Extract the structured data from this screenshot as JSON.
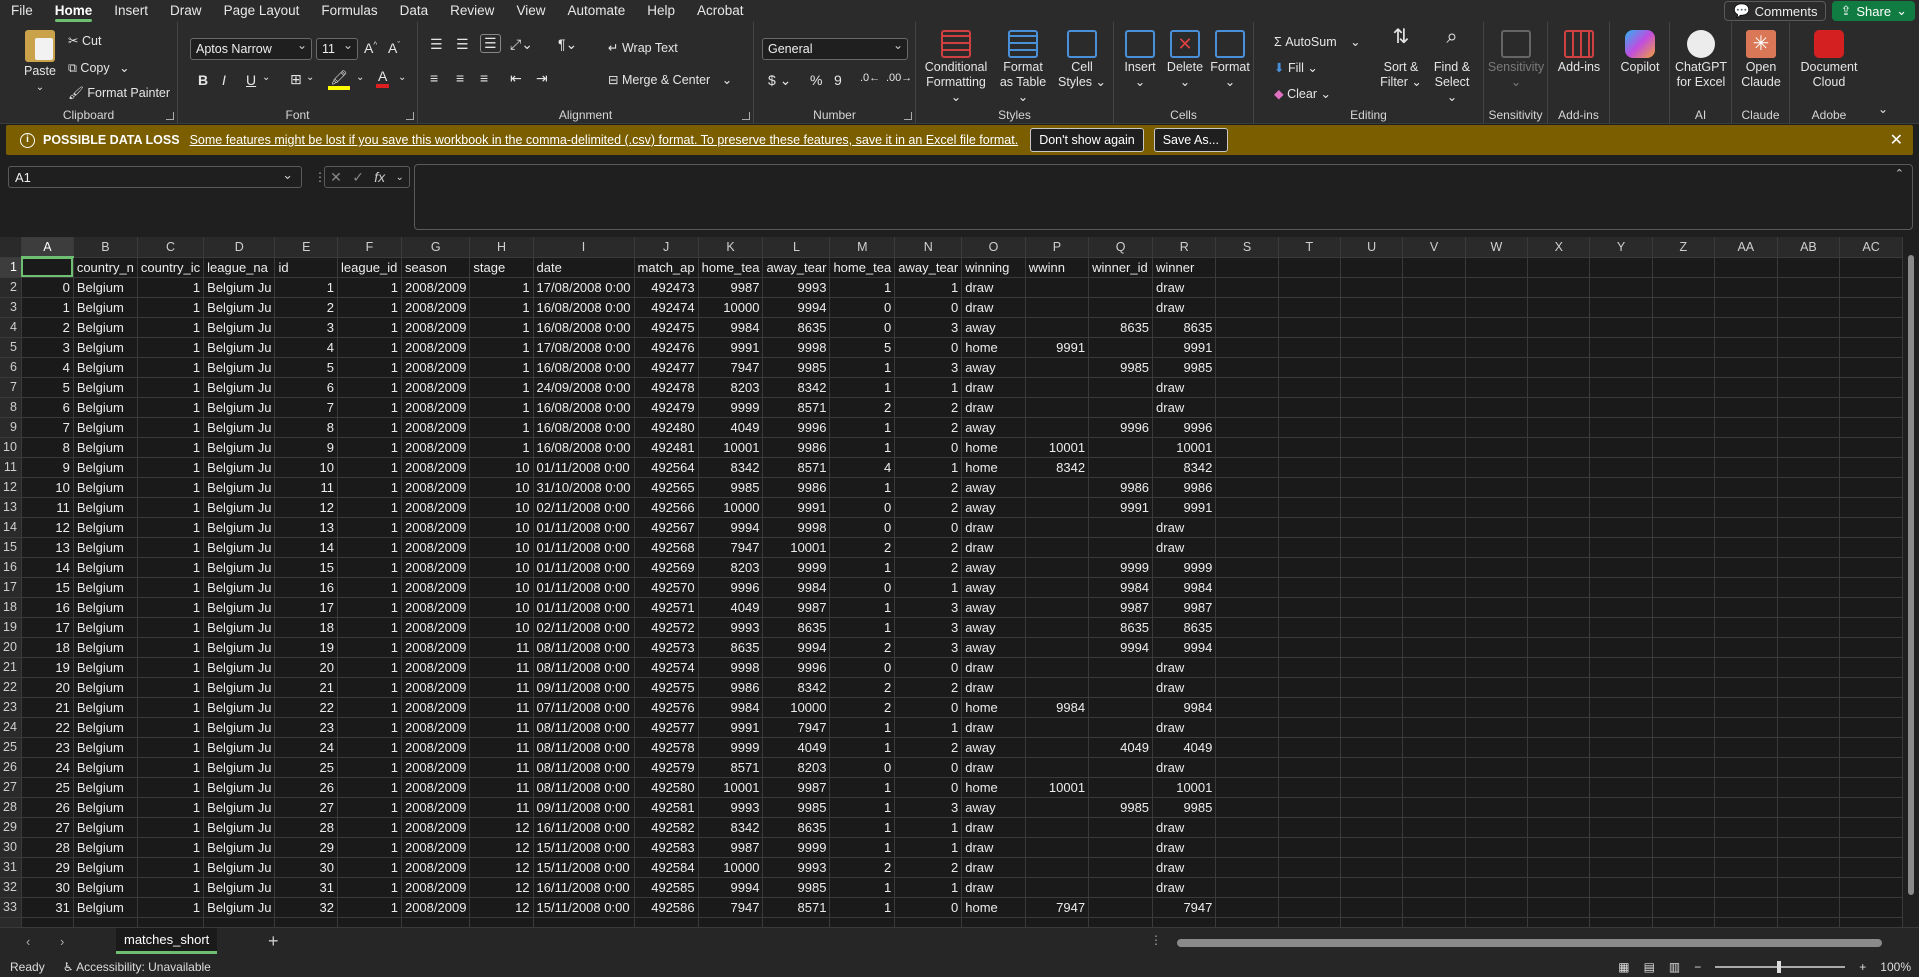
{
  "menu": {
    "items": [
      "File",
      "Home",
      "Insert",
      "Draw",
      "Page Layout",
      "Formulas",
      "Data",
      "Review",
      "View",
      "Automate",
      "Help",
      "Acrobat"
    ],
    "active": "Home",
    "comments_label": "Comments",
    "share_label": "Share"
  },
  "ribbon": {
    "clipboard": {
      "label": "Clipboard",
      "paste": "Paste",
      "cut": "Cut",
      "copy": "Copy",
      "format_painter": "Format Painter"
    },
    "font": {
      "label": "Font",
      "font_name": "Aptos Narrow",
      "font_size": "11"
    },
    "alignment": {
      "label": "Alignment",
      "wrap_text": "Wrap Text",
      "merge_center": "Merge & Center"
    },
    "number": {
      "label": "Number",
      "format": "General"
    },
    "styles": {
      "label": "Styles",
      "conditional": "Conditional Formatting",
      "format_table": "Format as Table",
      "cell_styles": "Cell Styles"
    },
    "cells": {
      "label": "Cells",
      "insert": "Insert",
      "delete": "Delete",
      "format": "Format"
    },
    "editing": {
      "label": "Editing",
      "autosum": "AutoSum",
      "fill": "Fill",
      "clear": "Clear",
      "sort_filter": "Sort & Filter",
      "find_select": "Find & Select"
    },
    "sensitivity": {
      "label": "Sensitivity",
      "button": "Sensitivity"
    },
    "addins": {
      "label": "Add-ins",
      "button": "Add-ins"
    },
    "copilot": {
      "button": "Copilot"
    },
    "ai": {
      "label": "AI",
      "button": "ChatGPT for Excel"
    },
    "claude": {
      "label": "Claude",
      "button": "Open Claude"
    },
    "adobe": {
      "label": "Adobe",
      "button": "Document Cloud"
    }
  },
  "message_bar": {
    "title": "POSSIBLE DATA LOSS",
    "text": "Some features might be lost if you save this workbook in the comma-delimited (.csv) format. To preserve these features, save it in an Excel file format.",
    "dont_show": "Don't show again",
    "save_as": "Save As..."
  },
  "formula_bar": {
    "name_box": "A1",
    "formula": ""
  },
  "grid": {
    "columns": [
      "A",
      "B",
      "C",
      "D",
      "E",
      "F",
      "G",
      "H",
      "I",
      "J",
      "K",
      "L",
      "M",
      "N",
      "O",
      "P",
      "Q",
      "R",
      "S",
      "T",
      "U",
      "V",
      "W",
      "X",
      "Y",
      "Z",
      "AA",
      "AB",
      "AC"
    ],
    "header_row": [
      "",
      "country_n",
      "country_ic",
      "league_na",
      "id",
      "league_id",
      "season",
      "stage",
      "date",
      "match_ap",
      "home_tea",
      "away_tear",
      "home_tea",
      "away_tear",
      "winning",
      "wwinn",
      "winner_id",
      "winner"
    ],
    "rows": [
      [
        "0",
        "Belgium",
        "1",
        "Belgium Ju",
        "1",
        "1",
        "2008/2009",
        "1",
        "17/08/2008 0:00",
        "492473",
        "9987",
        "9993",
        "1",
        "1",
        "draw",
        "",
        "",
        "draw"
      ],
      [
        "1",
        "Belgium",
        "1",
        "Belgium Ju",
        "2",
        "1",
        "2008/2009",
        "1",
        "16/08/2008 0:00",
        "492474",
        "10000",
        "9994",
        "0",
        "0",
        "draw",
        "",
        "",
        "draw"
      ],
      [
        "2",
        "Belgium",
        "1",
        "Belgium Ju",
        "3",
        "1",
        "2008/2009",
        "1",
        "16/08/2008 0:00",
        "492475",
        "9984",
        "8635",
        "0",
        "3",
        "away",
        "",
        "8635",
        "8635"
      ],
      [
        "3",
        "Belgium",
        "1",
        "Belgium Ju",
        "4",
        "1",
        "2008/2009",
        "1",
        "17/08/2008 0:00",
        "492476",
        "9991",
        "9998",
        "5",
        "0",
        "home",
        "9991",
        "",
        "9991"
      ],
      [
        "4",
        "Belgium",
        "1",
        "Belgium Ju",
        "5",
        "1",
        "2008/2009",
        "1",
        "16/08/2008 0:00",
        "492477",
        "7947",
        "9985",
        "1",
        "3",
        "away",
        "",
        "9985",
        "9985"
      ],
      [
        "5",
        "Belgium",
        "1",
        "Belgium Ju",
        "6",
        "1",
        "2008/2009",
        "1",
        "24/09/2008 0:00",
        "492478",
        "8203",
        "8342",
        "1",
        "1",
        "draw",
        "",
        "",
        "draw"
      ],
      [
        "6",
        "Belgium",
        "1",
        "Belgium Ju",
        "7",
        "1",
        "2008/2009",
        "1",
        "16/08/2008 0:00",
        "492479",
        "9999",
        "8571",
        "2",
        "2",
        "draw",
        "",
        "",
        "draw"
      ],
      [
        "7",
        "Belgium",
        "1",
        "Belgium Ju",
        "8",
        "1",
        "2008/2009",
        "1",
        "16/08/2008 0:00",
        "492480",
        "4049",
        "9996",
        "1",
        "2",
        "away",
        "",
        "9996",
        "9996"
      ],
      [
        "8",
        "Belgium",
        "1",
        "Belgium Ju",
        "9",
        "1",
        "2008/2009",
        "1",
        "16/08/2008 0:00",
        "492481",
        "10001",
        "9986",
        "1",
        "0",
        "home",
        "10001",
        "",
        "10001"
      ],
      [
        "9",
        "Belgium",
        "1",
        "Belgium Ju",
        "10",
        "1",
        "2008/2009",
        "10",
        "01/11/2008 0:00",
        "492564",
        "8342",
        "8571",
        "4",
        "1",
        "home",
        "8342",
        "",
        "8342"
      ],
      [
        "10",
        "Belgium",
        "1",
        "Belgium Ju",
        "11",
        "1",
        "2008/2009",
        "10",
        "31/10/2008 0:00",
        "492565",
        "9985",
        "9986",
        "1",
        "2",
        "away",
        "",
        "9986",
        "9986"
      ],
      [
        "11",
        "Belgium",
        "1",
        "Belgium Ju",
        "12",
        "1",
        "2008/2009",
        "10",
        "02/11/2008 0:00",
        "492566",
        "10000",
        "9991",
        "0",
        "2",
        "away",
        "",
        "9991",
        "9991"
      ],
      [
        "12",
        "Belgium",
        "1",
        "Belgium Ju",
        "13",
        "1",
        "2008/2009",
        "10",
        "01/11/2008 0:00",
        "492567",
        "9994",
        "9998",
        "0",
        "0",
        "draw",
        "",
        "",
        "draw"
      ],
      [
        "13",
        "Belgium",
        "1",
        "Belgium Ju",
        "14",
        "1",
        "2008/2009",
        "10",
        "01/11/2008 0:00",
        "492568",
        "7947",
        "10001",
        "2",
        "2",
        "draw",
        "",
        "",
        "draw"
      ],
      [
        "14",
        "Belgium",
        "1",
        "Belgium Ju",
        "15",
        "1",
        "2008/2009",
        "10",
        "01/11/2008 0:00",
        "492569",
        "8203",
        "9999",
        "1",
        "2",
        "away",
        "",
        "9999",
        "9999"
      ],
      [
        "15",
        "Belgium",
        "1",
        "Belgium Ju",
        "16",
        "1",
        "2008/2009",
        "10",
        "01/11/2008 0:00",
        "492570",
        "9996",
        "9984",
        "0",
        "1",
        "away",
        "",
        "9984",
        "9984"
      ],
      [
        "16",
        "Belgium",
        "1",
        "Belgium Ju",
        "17",
        "1",
        "2008/2009",
        "10",
        "01/11/2008 0:00",
        "492571",
        "4049",
        "9987",
        "1",
        "3",
        "away",
        "",
        "9987",
        "9987"
      ],
      [
        "17",
        "Belgium",
        "1",
        "Belgium Ju",
        "18",
        "1",
        "2008/2009",
        "10",
        "02/11/2008 0:00",
        "492572",
        "9993",
        "8635",
        "1",
        "3",
        "away",
        "",
        "8635",
        "8635"
      ],
      [
        "18",
        "Belgium",
        "1",
        "Belgium Ju",
        "19",
        "1",
        "2008/2009",
        "11",
        "08/11/2008 0:00",
        "492573",
        "8635",
        "9994",
        "2",
        "3",
        "away",
        "",
        "9994",
        "9994"
      ],
      [
        "19",
        "Belgium",
        "1",
        "Belgium Ju",
        "20",
        "1",
        "2008/2009",
        "11",
        "08/11/2008 0:00",
        "492574",
        "9998",
        "9996",
        "0",
        "0",
        "draw",
        "",
        "",
        "draw"
      ],
      [
        "20",
        "Belgium",
        "1",
        "Belgium Ju",
        "21",
        "1",
        "2008/2009",
        "11",
        "09/11/2008 0:00",
        "492575",
        "9986",
        "8342",
        "2",
        "2",
        "draw",
        "",
        "",
        "draw"
      ],
      [
        "21",
        "Belgium",
        "1",
        "Belgium Ju",
        "22",
        "1",
        "2008/2009",
        "11",
        "07/11/2008 0:00",
        "492576",
        "9984",
        "10000",
        "2",
        "0",
        "home",
        "9984",
        "",
        "9984"
      ],
      [
        "22",
        "Belgium",
        "1",
        "Belgium Ju",
        "23",
        "1",
        "2008/2009",
        "11",
        "08/11/2008 0:00",
        "492577",
        "9991",
        "7947",
        "1",
        "1",
        "draw",
        "",
        "",
        "draw"
      ],
      [
        "23",
        "Belgium",
        "1",
        "Belgium Ju",
        "24",
        "1",
        "2008/2009",
        "11",
        "08/11/2008 0:00",
        "492578",
        "9999",
        "4049",
        "1",
        "2",
        "away",
        "",
        "4049",
        "4049"
      ],
      [
        "24",
        "Belgium",
        "1",
        "Belgium Ju",
        "25",
        "1",
        "2008/2009",
        "11",
        "08/11/2008 0:00",
        "492579",
        "8571",
        "8203",
        "0",
        "0",
        "draw",
        "",
        "",
        "draw"
      ],
      [
        "25",
        "Belgium",
        "1",
        "Belgium Ju",
        "26",
        "1",
        "2008/2009",
        "11",
        "08/11/2008 0:00",
        "492580",
        "10001",
        "9987",
        "1",
        "0",
        "home",
        "10001",
        "",
        "10001"
      ],
      [
        "26",
        "Belgium",
        "1",
        "Belgium Ju",
        "27",
        "1",
        "2008/2009",
        "11",
        "09/11/2008 0:00",
        "492581",
        "9993",
        "9985",
        "1",
        "3",
        "away",
        "",
        "9985",
        "9985"
      ],
      [
        "27",
        "Belgium",
        "1",
        "Belgium Ju",
        "28",
        "1",
        "2008/2009",
        "12",
        "16/11/2008 0:00",
        "492582",
        "8342",
        "8635",
        "1",
        "1",
        "draw",
        "",
        "",
        "draw"
      ],
      [
        "28",
        "Belgium",
        "1",
        "Belgium Ju",
        "29",
        "1",
        "2008/2009",
        "12",
        "15/11/2008 0:00",
        "492583",
        "9987",
        "9999",
        "1",
        "1",
        "draw",
        "",
        "",
        "draw"
      ],
      [
        "29",
        "Belgium",
        "1",
        "Belgium Ju",
        "30",
        "1",
        "2008/2009",
        "12",
        "15/11/2008 0:00",
        "492584",
        "10000",
        "9993",
        "2",
        "2",
        "draw",
        "",
        "",
        "draw"
      ],
      [
        "30",
        "Belgium",
        "1",
        "Belgium Ju",
        "31",
        "1",
        "2008/2009",
        "12",
        "16/11/2008 0:00",
        "492585",
        "9994",
        "9985",
        "1",
        "1",
        "draw",
        "",
        "",
        "draw"
      ],
      [
        "31",
        "Belgium",
        "1",
        "Belgium Ju",
        "32",
        "1",
        "2008/2009",
        "12",
        "15/11/2008 0:00",
        "492586",
        "7947",
        "8571",
        "1",
        "0",
        "home",
        "7947",
        "",
        "7947"
      ]
    ]
  },
  "sheet_tabs": {
    "active": "matches_short"
  },
  "status": {
    "ready": "Ready",
    "accessibility": "Accessibility: Unavailable",
    "zoom": "100%"
  }
}
